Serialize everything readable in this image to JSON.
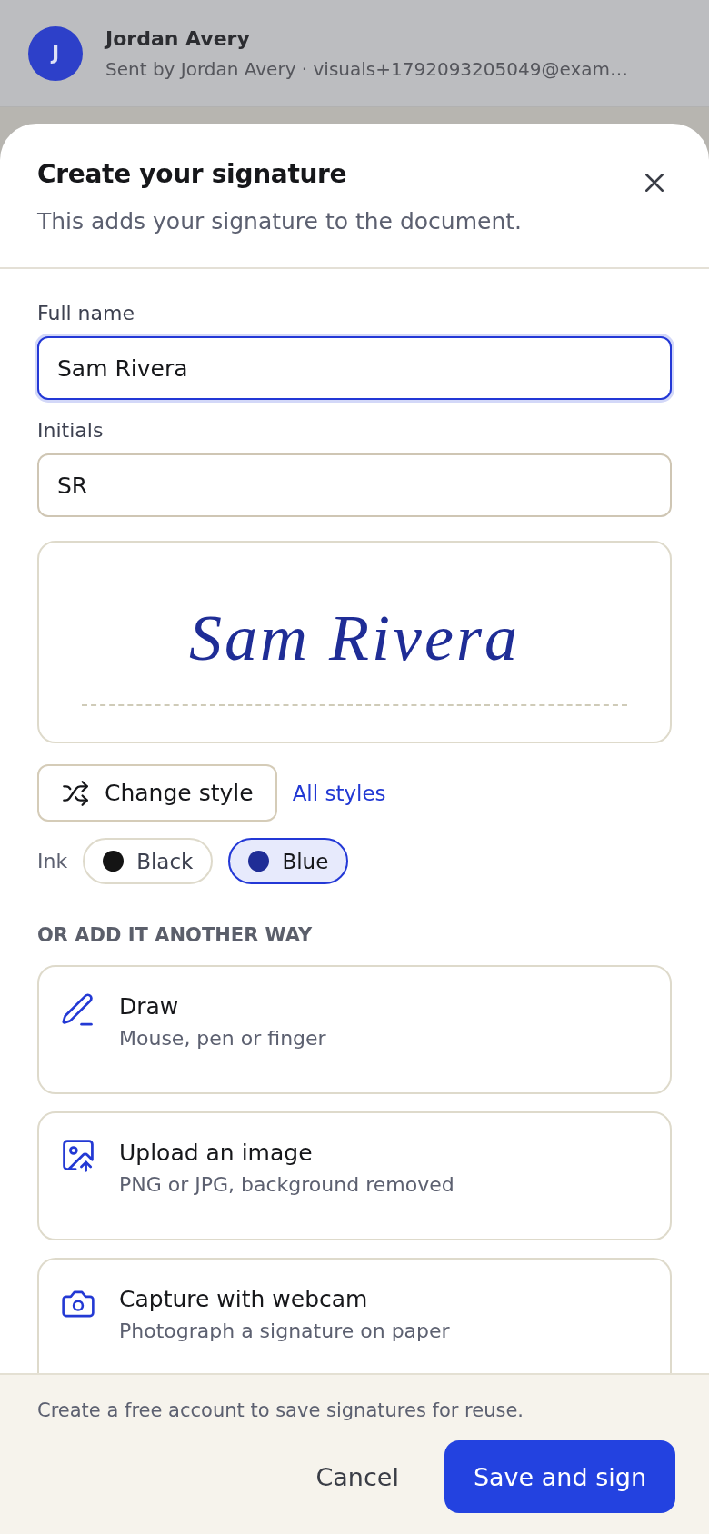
{
  "background": {
    "sender": {
      "avatar_initial": "J",
      "name": "Jordan Avery",
      "detail": "Sent by Jordan Avery · visuals+1792093205049@exam…"
    }
  },
  "dialog": {
    "title": "Create your signature",
    "subtitle": "This adds your signature to the document."
  },
  "fields": [
    {
      "label": "Full name",
      "value": "Sam Rivera",
      "focused": true
    },
    {
      "label": "Initials",
      "value": "SR",
      "focused": false
    }
  ],
  "preview": {
    "signature": "Sam Rivera"
  },
  "style_controls": {
    "change_button": "Change style",
    "all_link": "All styles"
  },
  "ink": {
    "label": "Ink",
    "options": [
      {
        "label": "Black",
        "color": "#141414",
        "selected": false
      },
      {
        "label": "Blue",
        "color": "#1f2d96",
        "selected": true
      }
    ]
  },
  "alternatives": {
    "heading": "OR ADD IT ANOTHER WAY",
    "options": [
      {
        "kind": "draw",
        "title": "Draw",
        "description": "Mouse, pen or finger"
      },
      {
        "kind": "upload",
        "title": "Upload an image",
        "description": "PNG or JPG, background removed"
      },
      {
        "kind": "webcam",
        "title": "Capture with webcam",
        "description": "Photograph a signature on paper"
      }
    ]
  },
  "footer": {
    "note": "Create a free account to save signatures for reuse.",
    "buttons": [
      {
        "kind": "text",
        "label": "Cancel"
      },
      {
        "kind": "primary",
        "label": "Save and sign"
      }
    ]
  }
}
